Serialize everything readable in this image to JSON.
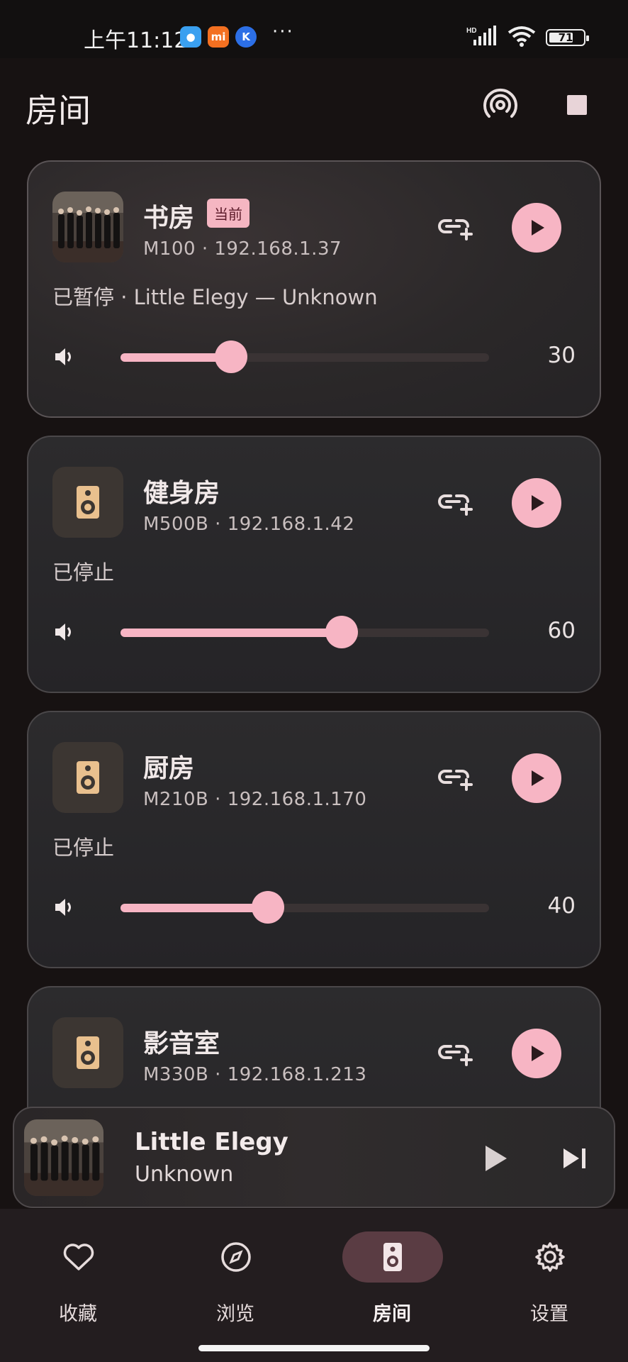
{
  "status_bar": {
    "time": "上午11:12",
    "apps": [
      "chat-icon",
      "mi-icon",
      "k-icon"
    ],
    "more": "···",
    "network": "HD",
    "battery": "71",
    "battery_level": 0.71
  },
  "header": {
    "title": "房间",
    "cast_icon": "broadcast-icon",
    "stop_icon": "stop-icon"
  },
  "rooms": [
    {
      "name": "书房",
      "badge": "当前",
      "subtitle": "M100 · 192.168.1.37",
      "status": "已暂停 · Little Elegy — Unknown",
      "volume": "30",
      "volume_fraction": 0.3,
      "artwork": "album-art"
    },
    {
      "name": "健身房",
      "subtitle": "M500B · 192.168.1.42",
      "status": "已停止",
      "volume": "60",
      "volume_fraction": 0.6,
      "artwork": "speaker-icon"
    },
    {
      "name": "厨房",
      "subtitle": "M210B · 192.168.1.170",
      "status": "已停止",
      "volume": "40",
      "volume_fraction": 0.4,
      "artwork": "speaker-icon"
    },
    {
      "name": "影音室",
      "subtitle": "M330B · 192.168.1.213",
      "artwork": "speaker-icon"
    }
  ],
  "mini_player": {
    "title": "Little Elegy",
    "artist": "Unknown"
  },
  "nav": [
    {
      "label": "收藏",
      "icon": "heart-icon"
    },
    {
      "label": "浏览",
      "icon": "compass-icon"
    },
    {
      "label": "房间",
      "icon": "speaker-icon",
      "active": true
    },
    {
      "label": "设置",
      "icon": "gear-icon"
    }
  ],
  "colors": {
    "accent": "#f7b5c4",
    "background": "#171212",
    "card": "#2c2b2d"
  }
}
